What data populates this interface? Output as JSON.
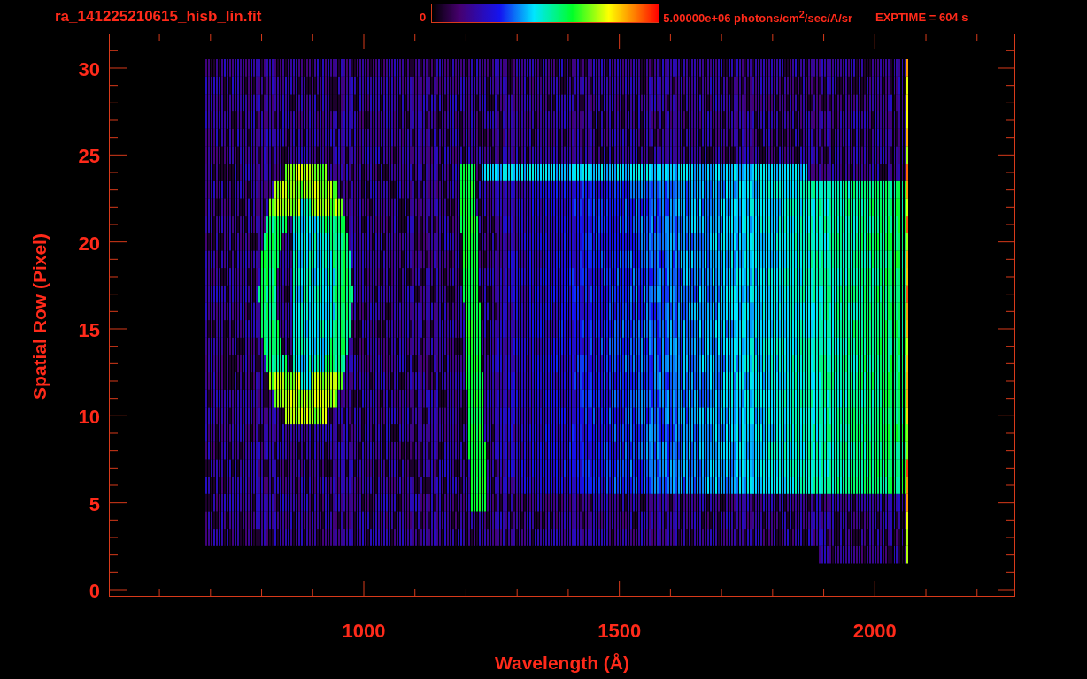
{
  "header": {
    "title": "ra_141225210615_hisb_lin.fit",
    "colorbar_min": "0",
    "colorbar_max": "5.00000e+06 photons/cm$^{2}$/sec/A/sr",
    "exptime": "EXPTIME = 604 s"
  },
  "plot": {
    "xlabel": "Wavelength (Å)",
    "ylabel": "Spatial Row (Pixel)",
    "xticks": [
      "1000",
      "1500",
      "2000"
    ],
    "yticks": [
      "30",
      "25",
      "20",
      "15",
      "10",
      "5",
      "0"
    ]
  }
}
